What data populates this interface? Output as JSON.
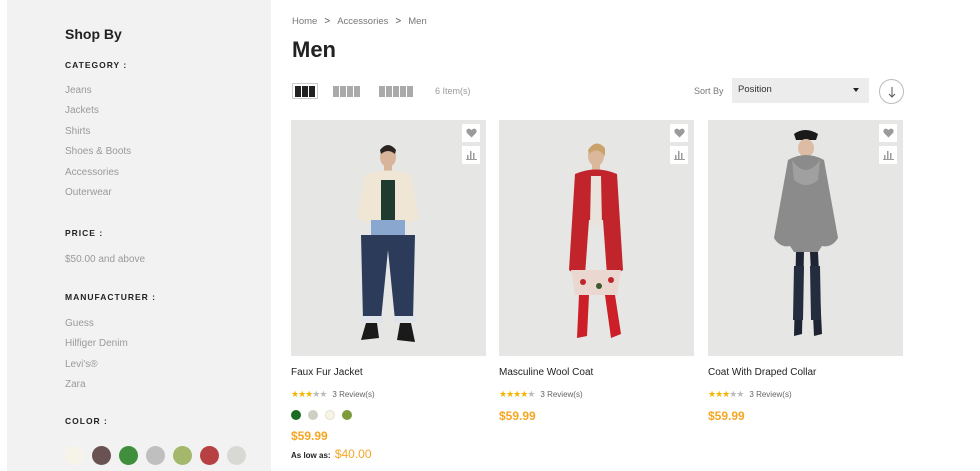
{
  "sidebar": {
    "title": "Shop By",
    "category": {
      "heading": "CATEGORY :",
      "items": [
        "Jeans",
        "Jackets",
        "Shirts",
        "Shoes & Boots",
        "Accessories",
        "Outerwear"
      ]
    },
    "price": {
      "heading": "PRICE :",
      "items": [
        "$50.00 and above"
      ]
    },
    "manufacturer": {
      "heading": "MANUFACTURER :",
      "items": [
        "Guess",
        "Hilfiger Denim",
        "Levi's®",
        "Zara"
      ]
    },
    "color": {
      "heading": "COLOR :",
      "swatches": [
        "#f6f4e9",
        "#6b5252",
        "#3f8f3c",
        "#bfbfbf",
        "#a4b86c",
        "#b74142",
        "#d8d8d4"
      ]
    }
  },
  "breadcrumb": {
    "items": [
      "Home",
      "Accessories",
      "Men"
    ],
    "separator": ">"
  },
  "page": {
    "title": "Men"
  },
  "toolbar": {
    "item_count": "6 Item(s)",
    "sort_label": "Sort By",
    "sort_value": "Position",
    "sort_direction_icon": "arrow-down-icon",
    "view_modes": [
      "grid-3",
      "grid-4",
      "grid-5"
    ],
    "active_view": "grid-3"
  },
  "products": [
    {
      "name": "Faux Fur Jacket",
      "rating": 3,
      "reviews": "3 Review(s)",
      "colors": [
        "#1b6b23",
        "#cfcfc4",
        "#f7f4e6",
        "#7d9a3c"
      ],
      "price": "$59.99",
      "as_low_as_label": "As low as:",
      "as_low_as_value": "$40.00"
    },
    {
      "name": "Masculine Wool Coat",
      "rating": 4,
      "reviews": "3 Review(s)",
      "price": "$59.99"
    },
    {
      "name": "Coat With Draped Collar",
      "rating": 3,
      "reviews": "3 Review(s)",
      "price": "$59.99"
    }
  ],
  "colors": {
    "accent_price": "#f5a623",
    "star": "#f5b400",
    "sidebar_bg": "#f2f2f2",
    "image_bg": "#e6e6e4"
  }
}
